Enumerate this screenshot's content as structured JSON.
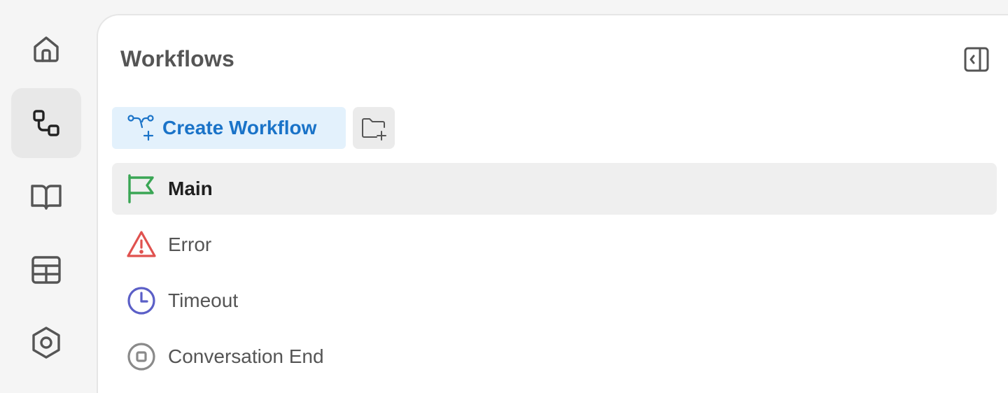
{
  "rail": {
    "items": [
      {
        "name": "home-icon",
        "active": false
      },
      {
        "name": "workflow-icon",
        "active": true
      },
      {
        "name": "book-icon",
        "active": false
      },
      {
        "name": "table-icon",
        "active": false
      },
      {
        "name": "settings-hexagon-icon",
        "active": false
      }
    ]
  },
  "panel": {
    "title": "Workflows",
    "create_label": "Create Workflow",
    "workflows": [
      {
        "label": "Main",
        "icon": "flag-icon",
        "color": "#3aa655",
        "selected": true
      },
      {
        "label": "Error",
        "icon": "warning-triangle-icon",
        "color": "#e0524f",
        "selected": false
      },
      {
        "label": "Timeout",
        "icon": "clock-icon",
        "color": "#5b5fc7",
        "selected": false
      },
      {
        "label": "Conversation End",
        "icon": "stop-circle-icon",
        "color": "#8a8a8a",
        "selected": false
      }
    ]
  },
  "colors": {
    "accent": "#1a73c8",
    "accent_bg": "#e3f1fc",
    "rail_icon": "#555555"
  }
}
